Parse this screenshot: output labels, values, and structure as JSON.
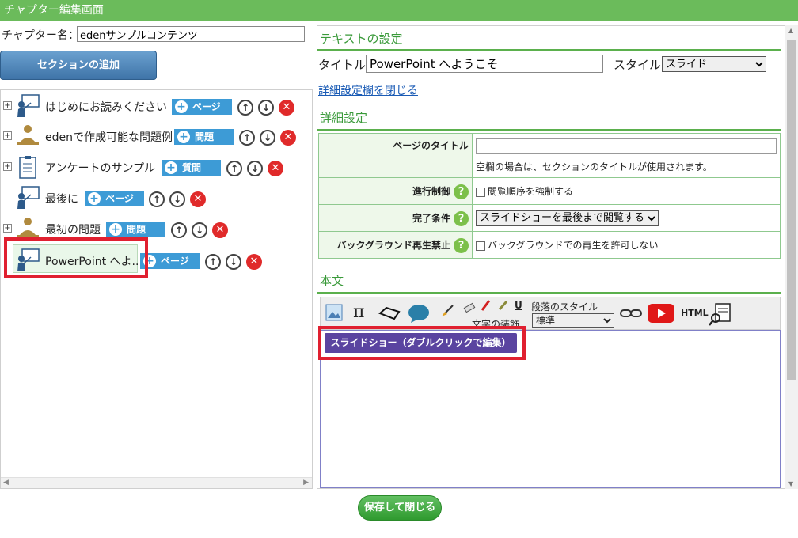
{
  "window": {
    "title": "チャプター編集画面"
  },
  "chapter": {
    "label": "チャプター名：",
    "value": "edenサンプルコンテンツ"
  },
  "add_section_label": "セクションの追加",
  "tree": {
    "items": [
      {
        "label": "はじめにお読みください",
        "badge": "ページ",
        "icon": "lecture-icon",
        "expander": "+"
      },
      {
        "label": "edenで作成可能な問題例",
        "badge": "問題",
        "icon": "student-icon",
        "expander": "+"
      },
      {
        "label": "アンケートのサンプル",
        "badge": "質問",
        "icon": "clipboard-icon",
        "expander": "+"
      },
      {
        "label": "最後に",
        "badge": "ページ",
        "icon": "lecture-icon",
        "expander": ""
      },
      {
        "label": "最初の問題",
        "badge": "問題",
        "icon": "student-icon",
        "expander": "+"
      },
      {
        "label": "PowerPoint へよ...",
        "badge": "ページ",
        "icon": "lecture-icon",
        "expander": ""
      }
    ]
  },
  "text_settings": {
    "heading": "テキストの設定",
    "title_label": "タイトル:",
    "title_value": "PowerPoint へようこそ",
    "style_label": "スタイル:",
    "style_value": "スライド",
    "toggle_link": "詳細設定欄を閉じる"
  },
  "detail": {
    "heading": "詳細設定",
    "page_title_label": "ページのタイトル",
    "page_title_value": "",
    "page_title_note": "空欄の場合は、セクションのタイトルが使用されます。",
    "progress_label": "進行制御",
    "progress_check": "閲覧順序を強制する",
    "completion_label": "完了条件",
    "completion_value": "スライドショーを最後まで閲覧する",
    "bg_label": "バックグラウンド再生禁止",
    "bg_check": "バックグラウンドでの再生を許可しない"
  },
  "body": {
    "heading": "本文",
    "decoration_label": "文字の装飾",
    "paragraph_label": "段落のスタイル",
    "paragraph_value": "標準",
    "html_label": "HTML",
    "slideshow_label": "スライドショー（ダブルクリックで編集）"
  },
  "save_label": "保存して閉じる",
  "colors": {
    "titlebar": "#6bbb5b",
    "badge": "#3d9bd6",
    "accent_green": "#3a9a3a",
    "highlight": "#e02030",
    "slideshow": "#5a44a0"
  }
}
